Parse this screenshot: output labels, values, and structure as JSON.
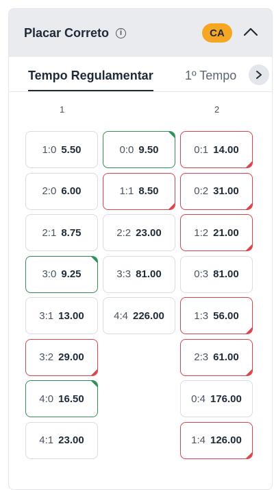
{
  "market": {
    "title": "Placar Correto",
    "badge": "CA",
    "info_icon": "info-icon",
    "collapse_icon": "chevron-up-icon"
  },
  "tabs": [
    {
      "label": "Tempo Regulamentar",
      "active": true
    },
    {
      "label": "1º Tempo",
      "active": false
    }
  ],
  "tab_scroll_icon": "chevron-right-icon",
  "columns": [
    "1",
    "",
    "2"
  ],
  "colors": {
    "up": "#2f8f55",
    "down": "#d9434a",
    "badge": "#f5a623"
  },
  "odds": {
    "home": [
      {
        "score": "1:0",
        "price": "5.50",
        "trend": "none"
      },
      {
        "score": "2:0",
        "price": "6.00",
        "trend": "none"
      },
      {
        "score": "2:1",
        "price": "8.75",
        "trend": "none"
      },
      {
        "score": "3:0",
        "price": "9.25",
        "trend": "up"
      },
      {
        "score": "3:1",
        "price": "13.00",
        "trend": "none"
      },
      {
        "score": "3:2",
        "price": "29.00",
        "trend": "down"
      },
      {
        "score": "4:0",
        "price": "16.50",
        "trend": "up"
      },
      {
        "score": "4:1",
        "price": "23.00",
        "trend": "none"
      }
    ],
    "draw": [
      {
        "score": "0:0",
        "price": "9.50",
        "trend": "up"
      },
      {
        "score": "1:1",
        "price": "8.50",
        "trend": "down"
      },
      {
        "score": "2:2",
        "price": "23.00",
        "trend": "none"
      },
      {
        "score": "3:3",
        "price": "81.00",
        "trend": "none"
      },
      {
        "score": "4:4",
        "price": "226.00",
        "trend": "none"
      }
    ],
    "away": [
      {
        "score": "0:1",
        "price": "14.00",
        "trend": "down"
      },
      {
        "score": "0:2",
        "price": "31.00",
        "trend": "down"
      },
      {
        "score": "1:2",
        "price": "21.00",
        "trend": "down"
      },
      {
        "score": "0:3",
        "price": "81.00",
        "trend": "none"
      },
      {
        "score": "1:3",
        "price": "56.00",
        "trend": "down"
      },
      {
        "score": "2:3",
        "price": "61.00",
        "trend": "down"
      },
      {
        "score": "0:4",
        "price": "176.00",
        "trend": "none"
      },
      {
        "score": "1:4",
        "price": "126.00",
        "trend": "down"
      }
    ]
  }
}
